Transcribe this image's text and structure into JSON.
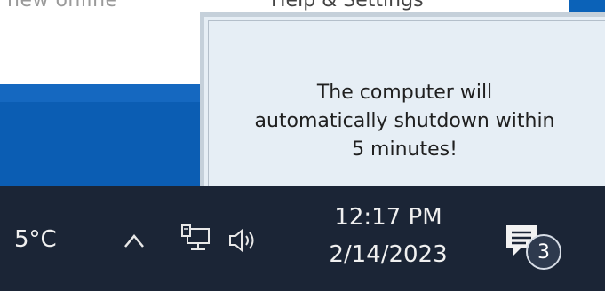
{
  "background_window": {
    "left_text": "new online",
    "center_text": "Help & Settings"
  },
  "notification": {
    "message": "The computer will\nautomatically shutdown within\n5 minutes!"
  },
  "taskbar": {
    "weather_temp": "5°C",
    "clock_time": "12:17 PM",
    "clock_date": "2/14/2023",
    "notification_count": "3",
    "icons": [
      "chevron-up-icon",
      "network-icon",
      "volume-icon",
      "notification-center-icon"
    ]
  }
}
